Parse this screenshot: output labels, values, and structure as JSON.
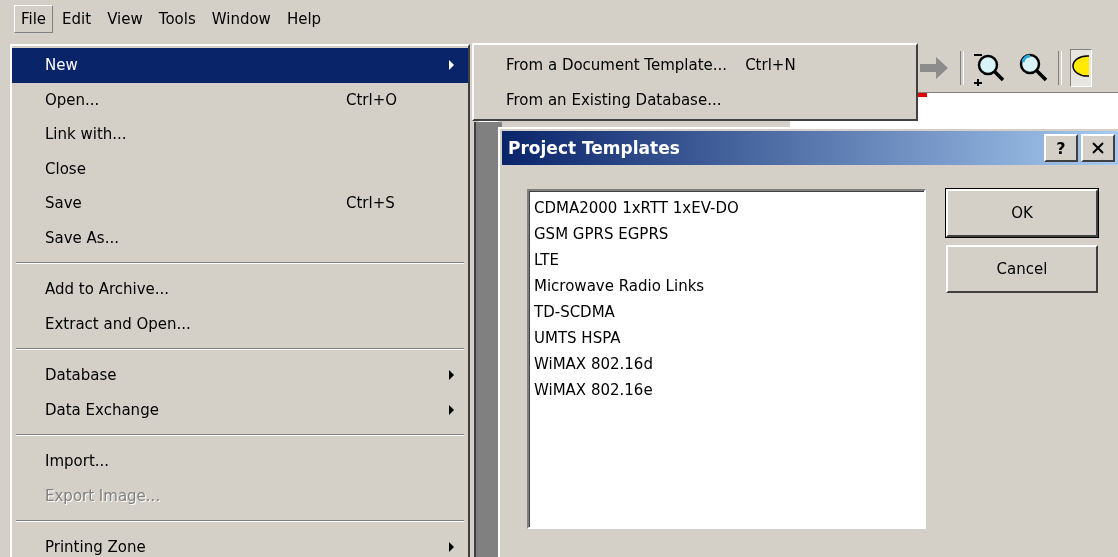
{
  "menu_bar": [
    {
      "label": "File",
      "selected": true
    },
    {
      "label": "Edit",
      "selected": false
    },
    {
      "label": "View",
      "selected": false
    },
    {
      "label": "Tools",
      "selected": false
    },
    {
      "label": "Window",
      "selected": false
    },
    {
      "label": "Help",
      "selected": false
    }
  ],
  "file_menu": [
    {
      "kind": "item",
      "label": "New",
      "submenu": true,
      "selected": true,
      "disabled": false
    },
    {
      "kind": "item",
      "label": "Open...",
      "shortcut": "Ctrl+O",
      "submenu": false,
      "selected": false,
      "disabled": false
    },
    {
      "kind": "item",
      "label": "Link with...",
      "submenu": false,
      "selected": false,
      "disabled": false
    },
    {
      "kind": "item",
      "label": "Close",
      "submenu": false,
      "selected": false,
      "disabled": false
    },
    {
      "kind": "item",
      "label": "Save",
      "shortcut": "Ctrl+S",
      "submenu": false,
      "selected": false,
      "disabled": false
    },
    {
      "kind": "item",
      "label": "Save As...",
      "submenu": false,
      "selected": false,
      "disabled": false
    },
    {
      "kind": "separator"
    },
    {
      "kind": "item",
      "label": "Add to Archive...",
      "submenu": false,
      "selected": false,
      "disabled": false
    },
    {
      "kind": "item",
      "label": "Extract and Open...",
      "submenu": false,
      "selected": false,
      "disabled": false
    },
    {
      "kind": "separator"
    },
    {
      "kind": "item",
      "label": "Database",
      "submenu": true,
      "selected": false,
      "disabled": false
    },
    {
      "kind": "item",
      "label": "Data Exchange",
      "submenu": true,
      "selected": false,
      "disabled": false
    },
    {
      "kind": "separator"
    },
    {
      "kind": "item",
      "label": "Import...",
      "submenu": false,
      "selected": false,
      "disabled": false
    },
    {
      "kind": "item",
      "label": "Export Image...",
      "submenu": false,
      "selected": false,
      "disabled": true
    },
    {
      "kind": "separator"
    },
    {
      "kind": "item",
      "label": "Printing Zone",
      "submenu": true,
      "selected": false,
      "disabled": false
    }
  ],
  "new_submenu": [
    {
      "label": "From a Document Template...",
      "shortcut": "Ctrl+N"
    },
    {
      "label": "From an Existing Database..."
    }
  ],
  "dialog": {
    "title": "Project Templates",
    "help_button": "?",
    "templates": [
      "CDMA2000 1xRTT 1xEV-DO",
      "GSM GPRS EGPRS",
      "LTE",
      "Microwave Radio Links",
      "TD-SCDMA",
      "UMTS HSPA",
      "WiMAX 802.16d",
      "WiMAX 802.16e"
    ],
    "buttons": [
      {
        "label": "OK",
        "default": true
      },
      {
        "label": "Cancel",
        "default": false
      }
    ]
  }
}
